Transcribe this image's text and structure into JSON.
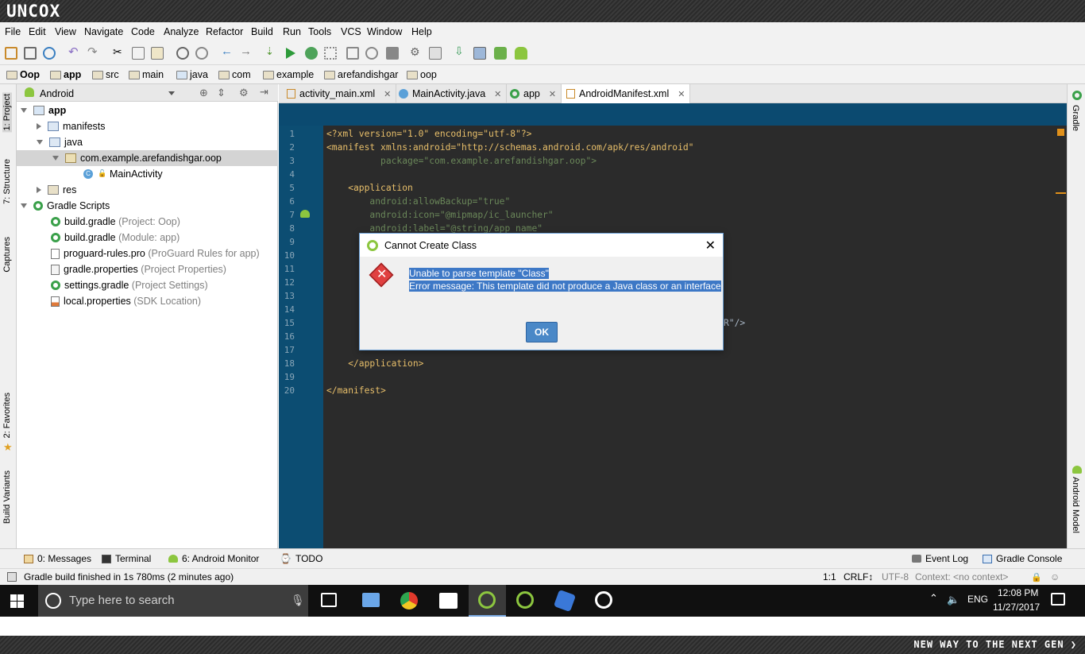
{
  "brand": "UNCOX",
  "menu": [
    "File",
    "Edit",
    "View",
    "Navigate",
    "Code",
    "Analyze",
    "Refactor",
    "Build",
    "Run",
    "Tools",
    "VCS",
    "Window",
    "Help"
  ],
  "breadcrumb": [
    "Oop",
    "app",
    "src",
    "main",
    "java",
    "com",
    "example",
    "arefandishgar",
    "oop"
  ],
  "left_stripe": {
    "project": "1: Project",
    "structure": "7: Structure",
    "captures": "Captures",
    "favorites": "2: Favorites",
    "build_variants": "Build Variants"
  },
  "right_stripe": {
    "gradle": "Gradle",
    "android_model": "Android Model"
  },
  "project_panel": {
    "view": "Android"
  },
  "tree": [
    {
      "label": "app",
      "hint": ""
    },
    {
      "label": "manifests",
      "hint": ""
    },
    {
      "label": "java",
      "hint": ""
    },
    {
      "label": "com.example.arefandishgar.oop",
      "hint": ""
    },
    {
      "label": "MainActivity",
      "hint": ""
    },
    {
      "label": "res",
      "hint": ""
    },
    {
      "label": "Gradle Scripts",
      "hint": ""
    },
    {
      "label": "build.gradle",
      "hint": "(Project: Oop)"
    },
    {
      "label": "build.gradle",
      "hint": "(Module: app)"
    },
    {
      "label": "proguard-rules.pro",
      "hint": "(ProGuard Rules for app)"
    },
    {
      "label": "gradle.properties",
      "hint": "(Project Properties)"
    },
    {
      "label": "settings.gradle",
      "hint": "(Project Settings)"
    },
    {
      "label": "local.properties",
      "hint": "(SDK Location)"
    }
  ],
  "tabs": [
    "activity_main.xml",
    "MainActivity.java",
    "app",
    "AndroidManifest.xml"
  ],
  "code_lines": [
    "1",
    "2",
    "3",
    "4",
    "5",
    "6",
    "7",
    "8",
    "9",
    "10",
    "11",
    "12",
    "13",
    "14",
    "15",
    "16",
    "17",
    "18",
    "19",
    "20"
  ],
  "code": {
    "l1": "<?xml version=\"1.0\" encoding=\"utf-8\"?>",
    "l2": "<manifest xmlns:android=\"http://schemas.android.com/apk/res/android\"",
    "l3": "          package=\"com.example.arefandishgar.oop\">",
    "l5": "    <application",
    "l6": "        android:allowBackup=\"true\"",
    "l7": "        android:icon=\"@mipmap/ic_launcher\"",
    "l8": "        android:label=\"@string/app_name\"",
    "l15": "R\"/>",
    "l18": "    </application>",
    "l20": "</manifest>"
  },
  "dialog": {
    "title": "Cannot Create Class",
    "line1": "Unable to parse template \"Class\"",
    "line2": "Error message: This template did not produce a Java class or an interface",
    "ok": "OK"
  },
  "bottom_tools": {
    "messages": "0: Messages",
    "terminal": "Terminal",
    "android_monitor": "6: Android Monitor",
    "todo": "TODO",
    "event_log": "Event Log",
    "gradle_console": "Gradle Console"
  },
  "status": {
    "message": "Gradle build finished in 1s 780ms (2 minutes ago)",
    "position": "1:1",
    "line_sep": "CRLF↕",
    "encoding": "UTF-8",
    "context": "Context: <no context>"
  },
  "taskbar": {
    "search_placeholder": "Type here to search",
    "lang": "ENG",
    "time": "12:08 PM",
    "date": "11/27/2017"
  },
  "footer": "NEW WAY TO THE NEXT GEN ❯",
  "colors": {
    "editor_bg": "#2b2b2b",
    "gutter": "#0c4d72",
    "selection": "#3d78c6",
    "ok_button": "#4a88c7"
  }
}
